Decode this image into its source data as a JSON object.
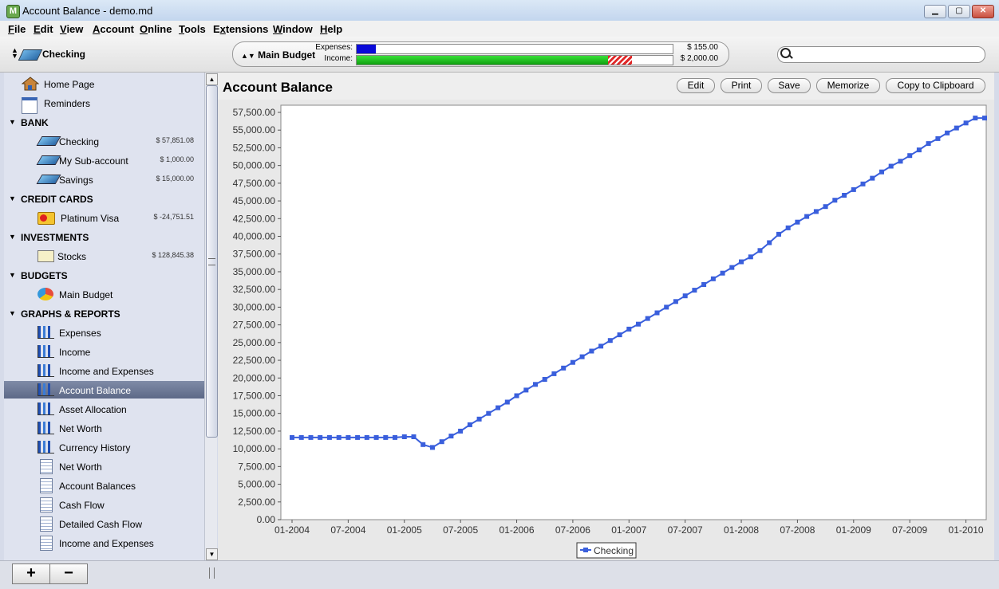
{
  "window": {
    "title": "Account Balance - demo.md",
    "app_icon": "M"
  },
  "menu": {
    "items": [
      "File",
      "Edit",
      "View",
      "Account",
      "Online",
      "Tools",
      "Extensions",
      "Window",
      "Help"
    ],
    "mnemonic_index": [
      0,
      0,
      0,
      0,
      0,
      0,
      1,
      0,
      0
    ]
  },
  "toolbar": {
    "account": "Checking",
    "budget": {
      "name": "Main Budget",
      "expenses_label": "Expenses:",
      "income_label": "Income:",
      "expenses_value": "$ 155.00",
      "income_value": "$ 2,000.00",
      "expenses_fill": 0.06,
      "income_fill": 0.795,
      "income_overflow_fill": 0.075
    },
    "search": {
      "placeholder": ""
    }
  },
  "sidebar": {
    "top_items": [
      {
        "label": "Home Page",
        "icon": "home-icon"
      },
      {
        "label": "Reminders",
        "icon": "reminders-icon"
      }
    ],
    "sections": [
      {
        "title": "BANK",
        "items": [
          {
            "label": "Checking",
            "amount": "$ 57,851.08",
            "icon": "bank-account-icon"
          },
          {
            "label": "My Sub-account",
            "amount": "$ 1,000.00",
            "icon": "bank-account-icon"
          },
          {
            "label": "Savings",
            "amount": "$ 15,000.00",
            "icon": "bank-account-icon"
          }
        ]
      },
      {
        "title": "CREDIT CARDS",
        "items": [
          {
            "label": "Platinum Visa",
            "amount": "$ -24,751.51",
            "icon": "credit-card-icon"
          }
        ]
      },
      {
        "title": "INVESTMENTS",
        "items": [
          {
            "label": "Stocks",
            "amount": "$ 128,845.38",
            "icon": "stocks-icon"
          }
        ]
      },
      {
        "title": "BUDGETS",
        "items": [
          {
            "label": "Main Budget",
            "amount": "",
            "icon": "budget-pie-icon"
          }
        ]
      },
      {
        "title": "GRAPHS & REPORTS",
        "items": [
          {
            "label": "Expenses",
            "icon": "graph-icon"
          },
          {
            "label": "Income",
            "icon": "graph-icon"
          },
          {
            "label": "Income and Expenses",
            "icon": "graph-icon"
          },
          {
            "label": "Account Balance",
            "icon": "graph-icon",
            "selected": true
          },
          {
            "label": "Asset Allocation",
            "icon": "graph-icon"
          },
          {
            "label": "Net Worth",
            "icon": "graph-icon"
          },
          {
            "label": "Currency History",
            "icon": "graph-icon"
          },
          {
            "label": "Net Worth",
            "icon": "report-icon"
          },
          {
            "label": "Account Balances",
            "icon": "report-icon"
          },
          {
            "label": "Cash Flow",
            "icon": "report-icon"
          },
          {
            "label": "Detailed Cash Flow",
            "icon": "report-icon"
          },
          {
            "label": "Income and Expenses",
            "icon": "report-icon"
          }
        ]
      }
    ]
  },
  "bottom": {
    "add_label": "+",
    "remove_label": "−"
  },
  "report": {
    "title": "Account Balance",
    "buttons": [
      "Edit",
      "Print",
      "Save",
      "Memorize",
      "Copy to Clipboard"
    ]
  },
  "colors": {
    "series": "#3a5fdc",
    "selected_row": "#66728f",
    "expenses_bar": "#0a0ad8",
    "income_bar": "#18c218",
    "overflow_bar": "#e02828"
  },
  "chart_data": {
    "type": "line",
    "title": "",
    "xlabel": "",
    "ylabel": "",
    "ylim": [
      0,
      57500
    ],
    "y_ticks": [
      "0.00",
      "2,500.00",
      "5,000.00",
      "7,500.00",
      "10,000.00",
      "12,500.00",
      "15,000.00",
      "17,500.00",
      "20,000.00",
      "22,500.00",
      "25,000.00",
      "27,500.00",
      "30,000.00",
      "32,500.00",
      "35,000.00",
      "37,500.00",
      "40,000.00",
      "42,500.00",
      "45,000.00",
      "47,500.00",
      "50,000.00",
      "52,500.00",
      "55,000.00",
      "57,500.00"
    ],
    "x_ticks": [
      "01-2004",
      "07-2004",
      "01-2005",
      "07-2005",
      "01-2006",
      "07-2006",
      "01-2007",
      "07-2007",
      "01-2008",
      "07-2008",
      "01-2009",
      "07-2009",
      "01-2010"
    ],
    "grid": false,
    "legend_position": "bottom-center",
    "series": [
      {
        "name": "Checking",
        "x_start": "01-2004",
        "x_step": "month",
        "values": [
          11600,
          11600,
          11600,
          11600,
          11600,
          11600,
          11600,
          11600,
          11600,
          11600,
          11600,
          11600,
          11700,
          11700,
          10600,
          10200,
          11000,
          11800,
          12500,
          13400,
          14200,
          15000,
          15800,
          16600,
          17500,
          18300,
          19100,
          19800,
          20600,
          21400,
          22200,
          23000,
          23800,
          24500,
          25300,
          26100,
          26900,
          27600,
          28400,
          29200,
          30000,
          30800,
          31600,
          32400,
          33200,
          34000,
          34800,
          35600,
          36400,
          37100,
          38000,
          39100,
          40300,
          41200,
          42000,
          42800,
          43500,
          44200,
          45100,
          45800,
          46600,
          47400,
          48200,
          49100,
          49900,
          50600,
          51400,
          52200,
          53100,
          53800,
          54600,
          55300,
          56000,
          56700,
          56700
        ]
      }
    ]
  }
}
